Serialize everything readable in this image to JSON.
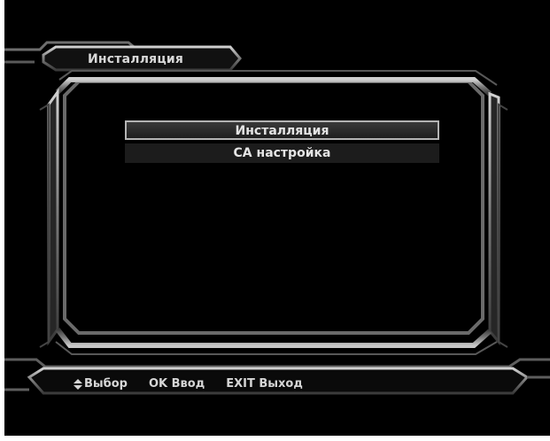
{
  "header": {
    "title": "Инсталляция"
  },
  "menu": {
    "items": [
      {
        "label": "Инсталляция",
        "selected": true
      },
      {
        "label": "CA  настройка",
        "selected": false
      }
    ]
  },
  "footer": {
    "select_icon": "up-down-arrows-icon",
    "select_label": "Выбор",
    "ok_key": "OK",
    "ok_label": "Ввод",
    "exit_key": "EXIT",
    "exit_label": "Выход"
  },
  "colors": {
    "background": "#000000",
    "frame": "#8a8a8a",
    "text": "#e2e2e2",
    "selection_border": "#b4b4b4"
  }
}
